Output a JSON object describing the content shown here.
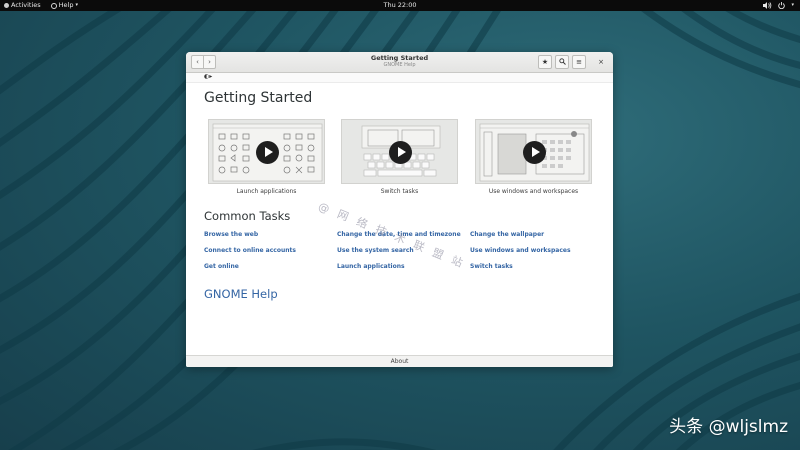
{
  "topbar": {
    "activities": "Activities",
    "help_menu": "Help",
    "clock": "Thu 22:00"
  },
  "window": {
    "title": "Getting Started",
    "subtitle": "GNOME Help",
    "page_title": "Getting Started",
    "videos": [
      {
        "label": "Launch applications"
      },
      {
        "label": "Switch tasks"
      },
      {
        "label": "Use windows and workspaces"
      }
    ],
    "common_tasks_title": "Common Tasks",
    "tasks": [
      "Browse the web",
      "Change the date, time and timezone",
      "Change the wallpaper",
      "Connect to online accounts",
      "Use the system search",
      "Use windows and workspaces",
      "Get online",
      "Launch applications",
      "Switch tasks"
    ],
    "gnome_help_title": "GNOME Help",
    "footer": "About"
  },
  "watermark": "@ 网 络 技 术 联 盟 站",
  "brand": "头条 @wljslmz",
  "colors": {
    "link": "#3465a4",
    "desktop": "#1f5562",
    "topbar": "#0b0b0b"
  }
}
